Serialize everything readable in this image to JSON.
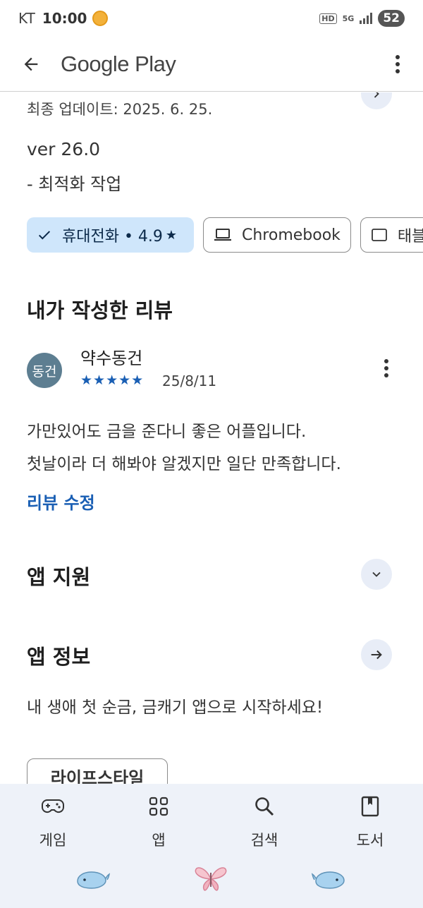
{
  "status_bar": {
    "carrier": "KT",
    "time": "10:00",
    "hd": "HD",
    "network": "5G",
    "battery": "52"
  },
  "app_bar": {
    "title": "Google Play"
  },
  "update": {
    "last_updated": "최종 업데이트: 2025. 6. 25."
  },
  "whats_new": {
    "version": "ver 26.0",
    "change": "- 최적화 작업"
  },
  "device_chips": [
    {
      "label": "휴대전화 • 4.9",
      "rating_star": "★",
      "selected": true
    },
    {
      "label": "Chromebook",
      "selected": false
    },
    {
      "label": "태블",
      "selected": false
    }
  ],
  "my_review": {
    "section_title": "내가 작성한 리뷰",
    "avatar_text": "동건",
    "reviewer": "약수동건",
    "stars": "★★★★★",
    "rating": 5,
    "date": "25/8/11",
    "text_line1": "가만있어도 금을 준다니 좋은 어플입니다.",
    "text_line2": "첫날이라 더 해봐야 알겠지만 일단 만족합니다.",
    "edit_label": "리뷰 수정"
  },
  "app_support": {
    "title": "앱 지원"
  },
  "app_info": {
    "title": "앱 정보",
    "description": "내 생애 첫 순금, 금캐기 앱으로 시작하세요!",
    "category": "라이프스타일"
  },
  "bottom_nav": [
    {
      "label": "게임",
      "icon": "gamepad-icon"
    },
    {
      "label": "앱",
      "icon": "apps-grid-icon"
    },
    {
      "label": "검색",
      "icon": "search-icon"
    },
    {
      "label": "도서",
      "icon": "book-icon"
    }
  ],
  "colors": {
    "accent": "#1a5fb4",
    "selected_chip_bg": "#cfe6fb",
    "nav_bg": "#eef2f9",
    "avatar_bg": "#5d7e91"
  }
}
